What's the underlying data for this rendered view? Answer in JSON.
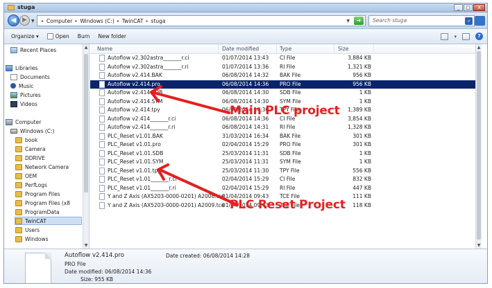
{
  "window": {
    "title": "stuga",
    "min": "_",
    "max": "□",
    "close": "X"
  },
  "address": {
    "crumbs": [
      "Computer",
      "Windows (C:)",
      "TwinCAT",
      "stuga"
    ],
    "search_placeholder": "Search stuga"
  },
  "commands": {
    "organize": "Organize ▾",
    "open": "Open",
    "burn": "Burn",
    "new_folder": "New folder"
  },
  "nav": {
    "recent": "Recent Places",
    "libraries": "Libraries",
    "documents": "Documents",
    "music": "Music",
    "pictures": "Pictures",
    "videos": "Videos",
    "computer": "Computer",
    "drive": "Windows (C:)",
    "folders": [
      "book",
      "Camera",
      "DDRIVE",
      "Network Camera",
      "OEM",
      "PerfLogs",
      "Program Files",
      "Program Files (x8",
      "ProgramData",
      "TwinCAT",
      "Users",
      "Windows"
    ]
  },
  "columns": {
    "name": "Name",
    "date": "Date modified",
    "type": "Type",
    "size": "Size"
  },
  "files": [
    {
      "name": "Autoflow v2.302astra_______r.ci",
      "date": "01/07/2014 13:43",
      "type": "CI File",
      "size": "3,884 KB"
    },
    {
      "name": "Autoflow v2.302astra_______r.ri",
      "date": "01/07/2014 13:36",
      "type": "RI File",
      "size": "1,321 KB"
    },
    {
      "name": "Autoflow v2.414.BAK",
      "date": "06/08/2014 14:32",
      "type": "BAK File",
      "size": "956 KB"
    },
    {
      "name": "Autoflow v2.414.pro",
      "date": "06/08/2014 14:36",
      "type": "PRO File",
      "size": "956 KB"
    },
    {
      "name": "Autoflow v2.414.SDB",
      "date": "06/08/2014 14:30",
      "type": "SDB File",
      "size": "1 KB"
    },
    {
      "name": "Autoflow v2.414.SYM",
      "date": "06/08/2014 14:30",
      "type": "SYM File",
      "size": "1 KB"
    },
    {
      "name": "Autoflow v2.414.tpy",
      "date": "06/08/2014 14:30",
      "type": "TPY File",
      "size": "1,389 KB"
    },
    {
      "name": "Autoflow v2.414_______r.ci",
      "date": "06/08/2014 14:36",
      "type": "CI File",
      "size": "3,854 KB"
    },
    {
      "name": "Autoflow v2.414_______r.ri",
      "date": "06/08/2014 14:31",
      "type": "RI File",
      "size": "1,328 KB"
    },
    {
      "name": "PLC_Reset v1.01.BAK",
      "date": "31/03/2014 16:34",
      "type": "BAK File",
      "size": "301 KB"
    },
    {
      "name": "PLC_Reset v1.01.pro",
      "date": "02/04/2014 15:29",
      "type": "PRO File",
      "size": "301 KB"
    },
    {
      "name": "PLC_Reset v1.01.SDB",
      "date": "25/03/2014 11:31",
      "type": "SDB File",
      "size": "1 KB"
    },
    {
      "name": "PLC_Reset v1.01.SYM",
      "date": "25/03/2014 11:31",
      "type": "SYM File",
      "size": "1 KB"
    },
    {
      "name": "PLC_Reset v1.01.tpy",
      "date": "25/03/2014 11:30",
      "type": "TPY File",
      "size": "556 KB"
    },
    {
      "name": "PLC_Reset v1.01_______r.ci",
      "date": "02/04/2014 15:29",
      "type": "CI File",
      "size": "832 KB"
    },
    {
      "name": "PLC_Reset v1.01_______r.ri",
      "date": "02/04/2014 15:29",
      "type": "RI File",
      "size": "447 KB"
    },
    {
      "name": "Y and Z Axis (AX5203-0000-0201) A2008.tce",
      "date": "01/04/2014 09:43",
      "type": "TCE File",
      "size": "111 KB"
    },
    {
      "name": "Y and Z Axis (AX5203-0000-0201) A2009.tce",
      "date": "01/04/2014 09:43",
      "type": "TCE File",
      "size": "118 KB"
    }
  ],
  "annotations": {
    "main": "Main PLC project",
    "reset": "PLC Reset Project"
  },
  "details": {
    "name": "Autoflow v2.414.pro",
    "type": "PRO File",
    "modified": "Date modified: 06/08/2014 14:36",
    "size": "Size: 955 KB",
    "created": "Date created: 06/08/2014 14:28"
  },
  "colors": {
    "annotation": "#e41f1f",
    "selection": "#0a246a"
  }
}
